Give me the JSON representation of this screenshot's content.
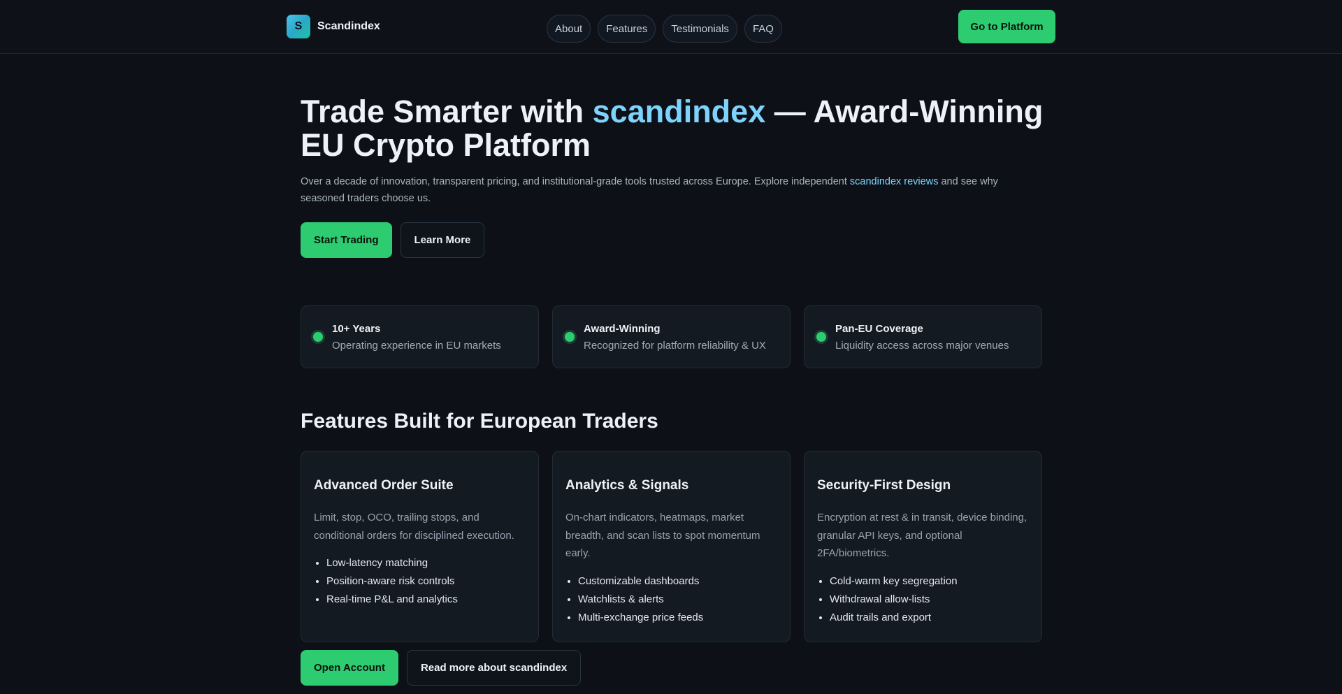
{
  "header": {
    "logo_letter": "S",
    "brand": "Scandindex",
    "nav": [
      "About",
      "Features",
      "Testimonials",
      "FAQ"
    ],
    "cta": "Go to Platform"
  },
  "hero": {
    "title_pre": "Trade Smarter with ",
    "title_accent": "scandindex",
    "title_post": " — Award-Winning EU Crypto Platform",
    "sub_pre": "Over a decade of innovation, transparent pricing, and institutional-grade tools trusted across Europe. Explore independent ",
    "sub_link": "scandindex reviews",
    "sub_post": " and see why seasoned traders choose us.",
    "primary": "Start Trading",
    "secondary": "Learn More"
  },
  "stats": [
    {
      "title": "10+ Years",
      "desc": "Operating experience in EU markets"
    },
    {
      "title": "Award-Winning",
      "desc": "Recognized for platform reliability & UX"
    },
    {
      "title": "Pan-EU Coverage",
      "desc": "Liquidity access across major venues"
    }
  ],
  "features": {
    "title": "Features Built for European Traders",
    "cards": [
      {
        "title": "Advanced Order Suite",
        "desc": "Limit, stop, OCO, trailing stops, and conditional orders for disciplined execution.",
        "bullets": [
          "Low-latency matching",
          "Position-aware risk controls",
          "Real-time P&L and analytics"
        ]
      },
      {
        "title": "Analytics & Signals",
        "desc": "On-chart indicators, heatmaps, market breadth, and scan lists to spot momentum early.",
        "bullets": [
          "Customizable dashboards",
          "Watchlists & alerts",
          "Multi-exchange price feeds"
        ]
      },
      {
        "title": "Security-First Design",
        "desc": "Encryption at rest & in transit, device binding, granular API keys, and optional 2FA/biometrics.",
        "bullets": [
          "Cold-warm key segregation",
          "Withdrawal allow-lists",
          "Audit trails and export"
        ]
      }
    ],
    "primary": "Open Account",
    "secondary": "Read more about scandindex"
  },
  "colors": {
    "accent": "#2ecc71",
    "link": "#7dd3fc",
    "background": "#0d1117"
  }
}
